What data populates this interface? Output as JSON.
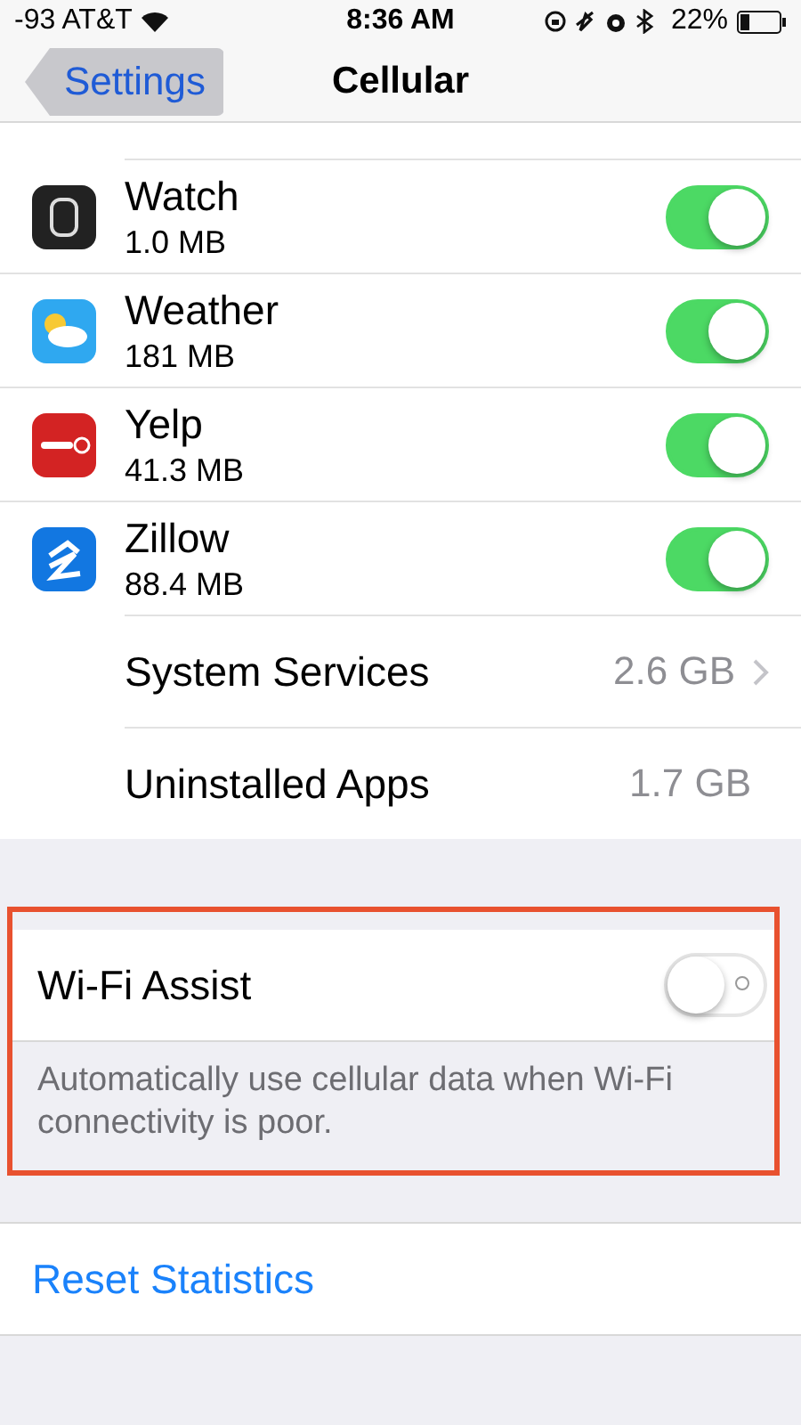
{
  "status_bar": {
    "carrier": "-93 AT&T",
    "time": "8:36 AM",
    "battery": "22%"
  },
  "nav": {
    "back": "Settings",
    "title": "Cellular"
  },
  "apps": [
    {
      "kind": "watch",
      "name": "Watch",
      "usage": "1.0 MB",
      "on": true
    },
    {
      "kind": "weather",
      "name": "Weather",
      "usage": "181 MB",
      "on": true
    },
    {
      "kind": "yelp",
      "name": "Yelp",
      "usage": "41.3 MB",
      "on": true
    },
    {
      "kind": "zillow",
      "name": "Zillow",
      "usage": "88.4 MB",
      "on": true
    }
  ],
  "totals": [
    {
      "kind": "link",
      "label": "System Services",
      "value": "2.6 GB"
    },
    {
      "kind": "plain",
      "label": "Uninstalled Apps",
      "value": "1.7 GB"
    }
  ],
  "wifi_assist": {
    "label": "Wi-Fi Assist",
    "on": false,
    "footer": "Automatically use cellular data when Wi-Fi connectivity is poor."
  },
  "reset": "Reset Statistics"
}
